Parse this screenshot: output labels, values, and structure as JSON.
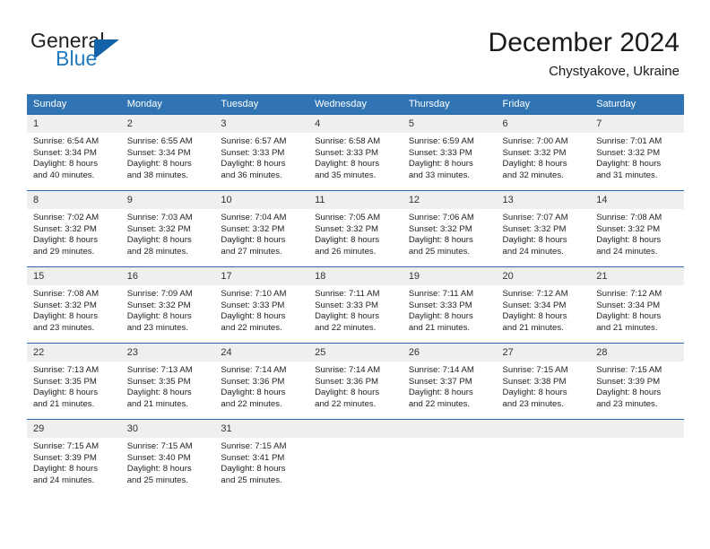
{
  "brand": {
    "name_top": "General",
    "name_bottom": "Blue",
    "accent_color": "#1f7ac1",
    "triangle_color": "#1463a8"
  },
  "header": {
    "title": "December 2024",
    "subtitle": "Chystyakove, Ukraine"
  },
  "theme": {
    "header_row_bg": "#3174b4",
    "daynum_bg": "#efefef",
    "row_divider": "#2b6ca8",
    "text": "#232323"
  },
  "weekdays": [
    "Sunday",
    "Monday",
    "Tuesday",
    "Wednesday",
    "Thursday",
    "Friday",
    "Saturday"
  ],
  "weeks": [
    [
      {
        "day": "1",
        "sunrise": "Sunrise: 6:54 AM",
        "sunset": "Sunset: 3:34 PM",
        "daylight1": "Daylight: 8 hours",
        "daylight2": "and 40 minutes."
      },
      {
        "day": "2",
        "sunrise": "Sunrise: 6:55 AM",
        "sunset": "Sunset: 3:34 PM",
        "daylight1": "Daylight: 8 hours",
        "daylight2": "and 38 minutes."
      },
      {
        "day": "3",
        "sunrise": "Sunrise: 6:57 AM",
        "sunset": "Sunset: 3:33 PM",
        "daylight1": "Daylight: 8 hours",
        "daylight2": "and 36 minutes."
      },
      {
        "day": "4",
        "sunrise": "Sunrise: 6:58 AM",
        "sunset": "Sunset: 3:33 PM",
        "daylight1": "Daylight: 8 hours",
        "daylight2": "and 35 minutes."
      },
      {
        "day": "5",
        "sunrise": "Sunrise: 6:59 AM",
        "sunset": "Sunset: 3:33 PM",
        "daylight1": "Daylight: 8 hours",
        "daylight2": "and 33 minutes."
      },
      {
        "day": "6",
        "sunrise": "Sunrise: 7:00 AM",
        "sunset": "Sunset: 3:32 PM",
        "daylight1": "Daylight: 8 hours",
        "daylight2": "and 32 minutes."
      },
      {
        "day": "7",
        "sunrise": "Sunrise: 7:01 AM",
        "sunset": "Sunset: 3:32 PM",
        "daylight1": "Daylight: 8 hours",
        "daylight2": "and 31 minutes."
      }
    ],
    [
      {
        "day": "8",
        "sunrise": "Sunrise: 7:02 AM",
        "sunset": "Sunset: 3:32 PM",
        "daylight1": "Daylight: 8 hours",
        "daylight2": "and 29 minutes."
      },
      {
        "day": "9",
        "sunrise": "Sunrise: 7:03 AM",
        "sunset": "Sunset: 3:32 PM",
        "daylight1": "Daylight: 8 hours",
        "daylight2": "and 28 minutes."
      },
      {
        "day": "10",
        "sunrise": "Sunrise: 7:04 AM",
        "sunset": "Sunset: 3:32 PM",
        "daylight1": "Daylight: 8 hours",
        "daylight2": "and 27 minutes."
      },
      {
        "day": "11",
        "sunrise": "Sunrise: 7:05 AM",
        "sunset": "Sunset: 3:32 PM",
        "daylight1": "Daylight: 8 hours",
        "daylight2": "and 26 minutes."
      },
      {
        "day": "12",
        "sunrise": "Sunrise: 7:06 AM",
        "sunset": "Sunset: 3:32 PM",
        "daylight1": "Daylight: 8 hours",
        "daylight2": "and 25 minutes."
      },
      {
        "day": "13",
        "sunrise": "Sunrise: 7:07 AM",
        "sunset": "Sunset: 3:32 PM",
        "daylight1": "Daylight: 8 hours",
        "daylight2": "and 24 minutes."
      },
      {
        "day": "14",
        "sunrise": "Sunrise: 7:08 AM",
        "sunset": "Sunset: 3:32 PM",
        "daylight1": "Daylight: 8 hours",
        "daylight2": "and 24 minutes."
      }
    ],
    [
      {
        "day": "15",
        "sunrise": "Sunrise: 7:08 AM",
        "sunset": "Sunset: 3:32 PM",
        "daylight1": "Daylight: 8 hours",
        "daylight2": "and 23 minutes."
      },
      {
        "day": "16",
        "sunrise": "Sunrise: 7:09 AM",
        "sunset": "Sunset: 3:32 PM",
        "daylight1": "Daylight: 8 hours",
        "daylight2": "and 23 minutes."
      },
      {
        "day": "17",
        "sunrise": "Sunrise: 7:10 AM",
        "sunset": "Sunset: 3:33 PM",
        "daylight1": "Daylight: 8 hours",
        "daylight2": "and 22 minutes."
      },
      {
        "day": "18",
        "sunrise": "Sunrise: 7:11 AM",
        "sunset": "Sunset: 3:33 PM",
        "daylight1": "Daylight: 8 hours",
        "daylight2": "and 22 minutes."
      },
      {
        "day": "19",
        "sunrise": "Sunrise: 7:11 AM",
        "sunset": "Sunset: 3:33 PM",
        "daylight1": "Daylight: 8 hours",
        "daylight2": "and 21 minutes."
      },
      {
        "day": "20",
        "sunrise": "Sunrise: 7:12 AM",
        "sunset": "Sunset: 3:34 PM",
        "daylight1": "Daylight: 8 hours",
        "daylight2": "and 21 minutes."
      },
      {
        "day": "21",
        "sunrise": "Sunrise: 7:12 AM",
        "sunset": "Sunset: 3:34 PM",
        "daylight1": "Daylight: 8 hours",
        "daylight2": "and 21 minutes."
      }
    ],
    [
      {
        "day": "22",
        "sunrise": "Sunrise: 7:13 AM",
        "sunset": "Sunset: 3:35 PM",
        "daylight1": "Daylight: 8 hours",
        "daylight2": "and 21 minutes."
      },
      {
        "day": "23",
        "sunrise": "Sunrise: 7:13 AM",
        "sunset": "Sunset: 3:35 PM",
        "daylight1": "Daylight: 8 hours",
        "daylight2": "and 21 minutes."
      },
      {
        "day": "24",
        "sunrise": "Sunrise: 7:14 AM",
        "sunset": "Sunset: 3:36 PM",
        "daylight1": "Daylight: 8 hours",
        "daylight2": "and 22 minutes."
      },
      {
        "day": "25",
        "sunrise": "Sunrise: 7:14 AM",
        "sunset": "Sunset: 3:36 PM",
        "daylight1": "Daylight: 8 hours",
        "daylight2": "and 22 minutes."
      },
      {
        "day": "26",
        "sunrise": "Sunrise: 7:14 AM",
        "sunset": "Sunset: 3:37 PM",
        "daylight1": "Daylight: 8 hours",
        "daylight2": "and 22 minutes."
      },
      {
        "day": "27",
        "sunrise": "Sunrise: 7:15 AM",
        "sunset": "Sunset: 3:38 PM",
        "daylight1": "Daylight: 8 hours",
        "daylight2": "and 23 minutes."
      },
      {
        "day": "28",
        "sunrise": "Sunrise: 7:15 AM",
        "sunset": "Sunset: 3:39 PM",
        "daylight1": "Daylight: 8 hours",
        "daylight2": "and 23 minutes."
      }
    ],
    [
      {
        "day": "29",
        "sunrise": "Sunrise: 7:15 AM",
        "sunset": "Sunset: 3:39 PM",
        "daylight1": "Daylight: 8 hours",
        "daylight2": "and 24 minutes."
      },
      {
        "day": "30",
        "sunrise": "Sunrise: 7:15 AM",
        "sunset": "Sunset: 3:40 PM",
        "daylight1": "Daylight: 8 hours",
        "daylight2": "and 25 minutes."
      },
      {
        "day": "31",
        "sunrise": "Sunrise: 7:15 AM",
        "sunset": "Sunset: 3:41 PM",
        "daylight1": "Daylight: 8 hours",
        "daylight2": "and 25 minutes."
      },
      {
        "day": "",
        "sunrise": "",
        "sunset": "",
        "daylight1": "",
        "daylight2": ""
      },
      {
        "day": "",
        "sunrise": "",
        "sunset": "",
        "daylight1": "",
        "daylight2": ""
      },
      {
        "day": "",
        "sunrise": "",
        "sunset": "",
        "daylight1": "",
        "daylight2": ""
      },
      {
        "day": "",
        "sunrise": "",
        "sunset": "",
        "daylight1": "",
        "daylight2": ""
      }
    ]
  ]
}
